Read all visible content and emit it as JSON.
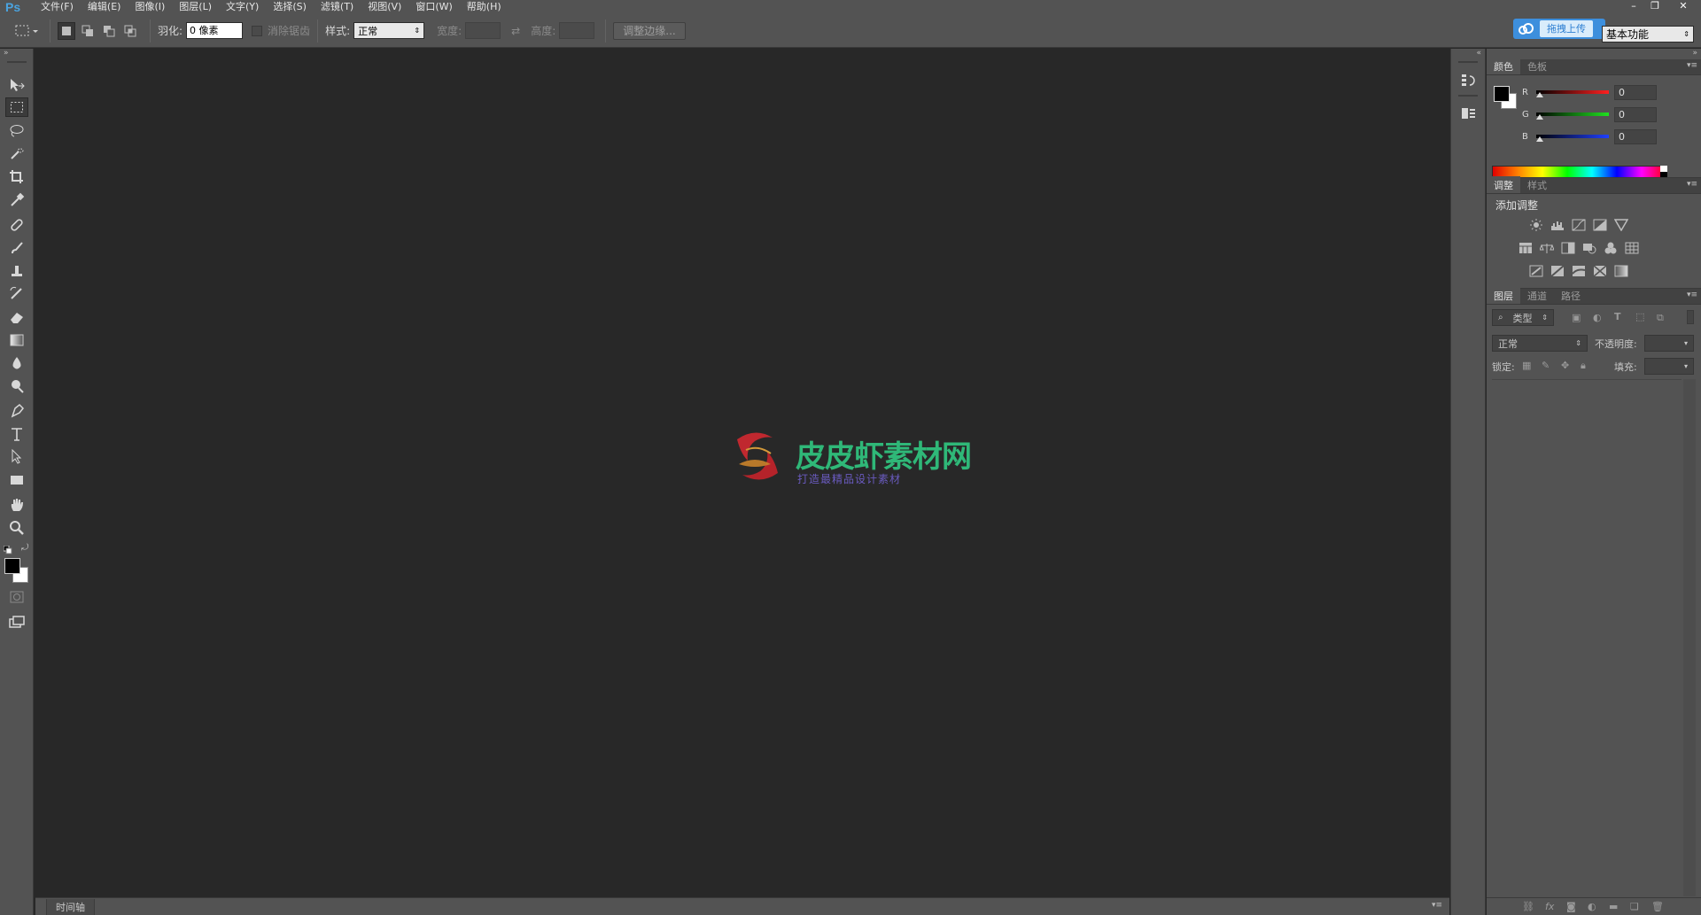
{
  "app": {
    "logo": "Ps"
  },
  "menu": [
    {
      "label": "文件(F)"
    },
    {
      "label": "编辑(E)"
    },
    {
      "label": "图像(I)"
    },
    {
      "label": "图层(L)"
    },
    {
      "label": "文字(Y)"
    },
    {
      "label": "选择(S)"
    },
    {
      "label": "滤镜(T)"
    },
    {
      "label": "视图(V)"
    },
    {
      "label": "窗口(W)"
    },
    {
      "label": "帮助(H)"
    }
  ],
  "window_controls": {
    "minimize": "–",
    "restore": "❐",
    "close": "✕"
  },
  "options": {
    "feather_label": "羽化:",
    "feather_value": "0 像素",
    "antialias_label": "消除锯齿",
    "style_label": "样式:",
    "style_value": "正常",
    "width_label": "宽度:",
    "height_label": "高度:",
    "refine_edge": "调整边缘..."
  },
  "upload": {
    "label": "拖拽上传"
  },
  "workspace": {
    "value": "基本功能"
  },
  "watermark": {
    "title": "皮皮虾素材网",
    "subtitle": "打造最精品设计素材"
  },
  "timeline": {
    "tab": "时间轴"
  },
  "color_panel": {
    "tabs": [
      "颜色",
      "色板"
    ],
    "channels": [
      {
        "label": "R",
        "value": "0",
        "color": "#e02020"
      },
      {
        "label": "G",
        "value": "0",
        "color": "#20c020"
      },
      {
        "label": "B",
        "value": "0",
        "color": "#2040e0"
      }
    ]
  },
  "adjust_panel": {
    "tabs": [
      "调整",
      "样式"
    ],
    "heading": "添加调整"
  },
  "layers_panel": {
    "tabs": [
      "图层",
      "通道",
      "路径"
    ],
    "filter_kind": "类型",
    "blend_mode": "正常",
    "opacity_label": "不透明度:",
    "lock_label": "锁定:",
    "fill_label": "填充:"
  },
  "colors": {
    "accent_blue": "#3d8fdd",
    "ui_gray": "#535353",
    "canvas": "#282828",
    "watermark_green": "#2fb878",
    "watermark_red": "#c0282f"
  }
}
